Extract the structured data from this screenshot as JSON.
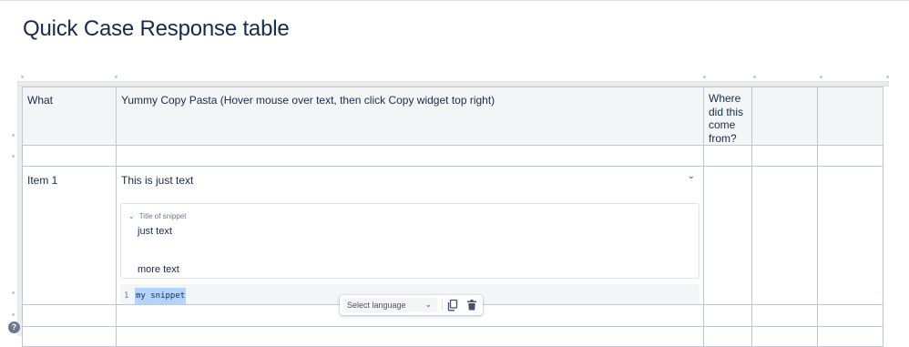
{
  "page": {
    "title": "Quick Case Response table"
  },
  "table": {
    "headers": {
      "what": "What",
      "yummy": "Yummy Copy Pasta (Hover mouse over text, then click Copy widget top right)",
      "where": "Where did this come from?"
    },
    "rows": [
      {
        "what": "Item 1",
        "text": "This is just text",
        "expand": {
          "title": "Title of snippet",
          "body_line_1": "just text",
          "body_line_2": "more text"
        },
        "code": {
          "line_number": "1",
          "content": "my snippet"
        }
      }
    ]
  },
  "code_toolbar": {
    "language_placeholder": "Select language",
    "icons": [
      "chevron-down-icon",
      "copy-icon",
      "trash-icon"
    ]
  },
  "help": {
    "label": "?"
  },
  "colors": {
    "text": "#172b4d",
    "border": "#c1c7d0",
    "header_bg": "#f4f5f7",
    "selection": "#b3d4ff",
    "subtle": "#6b778c"
  }
}
